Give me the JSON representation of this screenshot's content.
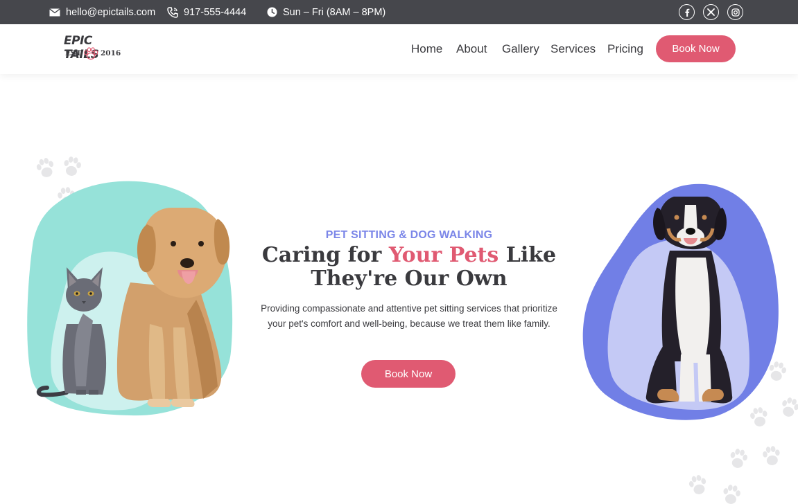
{
  "topbar": {
    "email": "hello@epictails.com",
    "phone": "917-555-4444",
    "hours": "Sun – Fri (8AM – 8PM)",
    "social": [
      "facebook-icon",
      "x-icon",
      "instagram-icon"
    ]
  },
  "logo": {
    "title": "EPIC TAILS",
    "est": "EST",
    "year": "2016"
  },
  "nav": {
    "items": [
      "Home",
      "About",
      "Gallery",
      "Services",
      "Pricing"
    ],
    "cta": "Book Now"
  },
  "hero": {
    "eyebrow": "PET SITTING & DOG WALKING",
    "headline_pre": "Caring for ",
    "headline_accent": "Your Pets",
    "headline_post": " Like They're Our Own",
    "description": "Providing compassionate and attentive pet sitting services that prioritize your pet's comfort and well-being, because we treat them like family.",
    "cta": "Book Now"
  },
  "colors": {
    "topbar": "#46474c",
    "accent_pink": "#e05a72",
    "accent_blue": "#7b86e8",
    "teal_blob": "#96e2d9",
    "teal_light": "#cdf1ee",
    "purple_blob": "#717fe6",
    "purple_light": "#c4c9f5",
    "paw_gray": "#e4e4e6"
  }
}
